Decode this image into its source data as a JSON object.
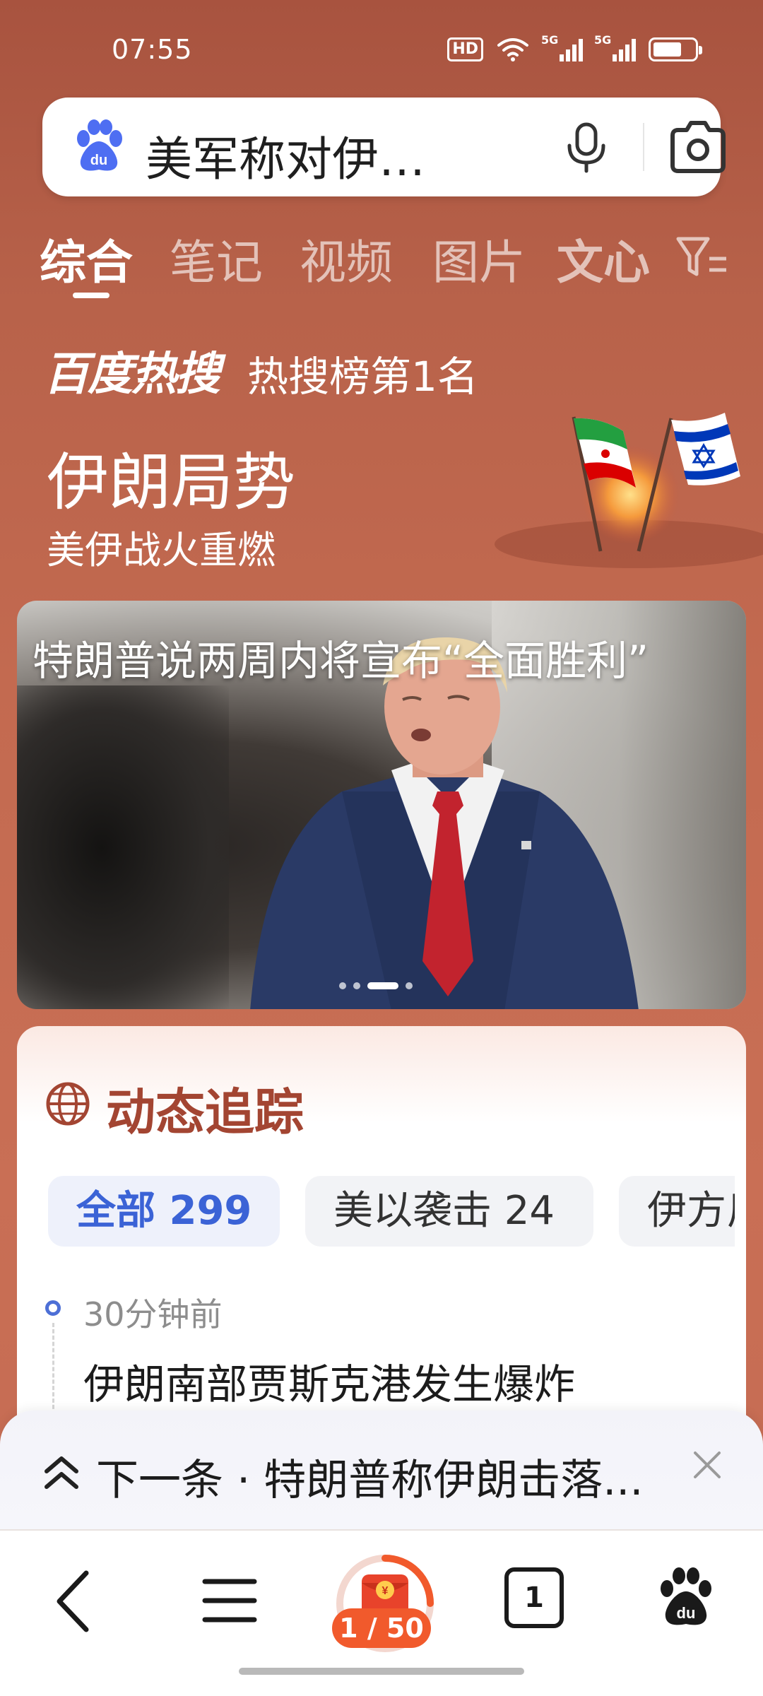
{
  "status_bar": {
    "time": "07:55",
    "hd_label": "HD",
    "signal_1": "5G",
    "signal_2": "5G",
    "battery_level": 0.7
  },
  "search": {
    "query": "美军称对伊…",
    "icons": [
      "baidu-paw-icon",
      "microphone-icon",
      "camera-icon"
    ]
  },
  "tabs": {
    "items": [
      {
        "label": "综合",
        "active": true
      },
      {
        "label": "笔记",
        "active": false
      },
      {
        "label": "视频",
        "active": false
      },
      {
        "label": "图片",
        "active": false
      },
      {
        "label": "文心",
        "active": false
      }
    ]
  },
  "hot_search": {
    "logo": "百度热搜",
    "rank": "热搜榜第1名",
    "title": "伊朗局势",
    "subtitle": "美伊战火重燃"
  },
  "hero": {
    "headline": "特朗普说两周内将宣布“全面胜利”",
    "slide_count": 4,
    "active_slide": 3
  },
  "tracking": {
    "title": "动态追踪",
    "chips": [
      {
        "label": "全部 299",
        "active": true
      },
      {
        "label": "美以袭击 24",
        "active": false
      },
      {
        "label": "伊方反",
        "active": false
      }
    ],
    "items": [
      {
        "time": "30分钟前",
        "title": "伊朗南部贾斯克港发生爆炸"
      }
    ]
  },
  "next": {
    "text": "下一条 · 特朗普称伊朗击落..."
  },
  "bottom_nav": {
    "red_packet_count": "1 / 50",
    "tab_count": "1"
  },
  "colors": {
    "background": "#c36a50",
    "accent_blue": "#3b63d6",
    "tracking_title": "#a34532",
    "red_badge": "#f15a2c"
  }
}
